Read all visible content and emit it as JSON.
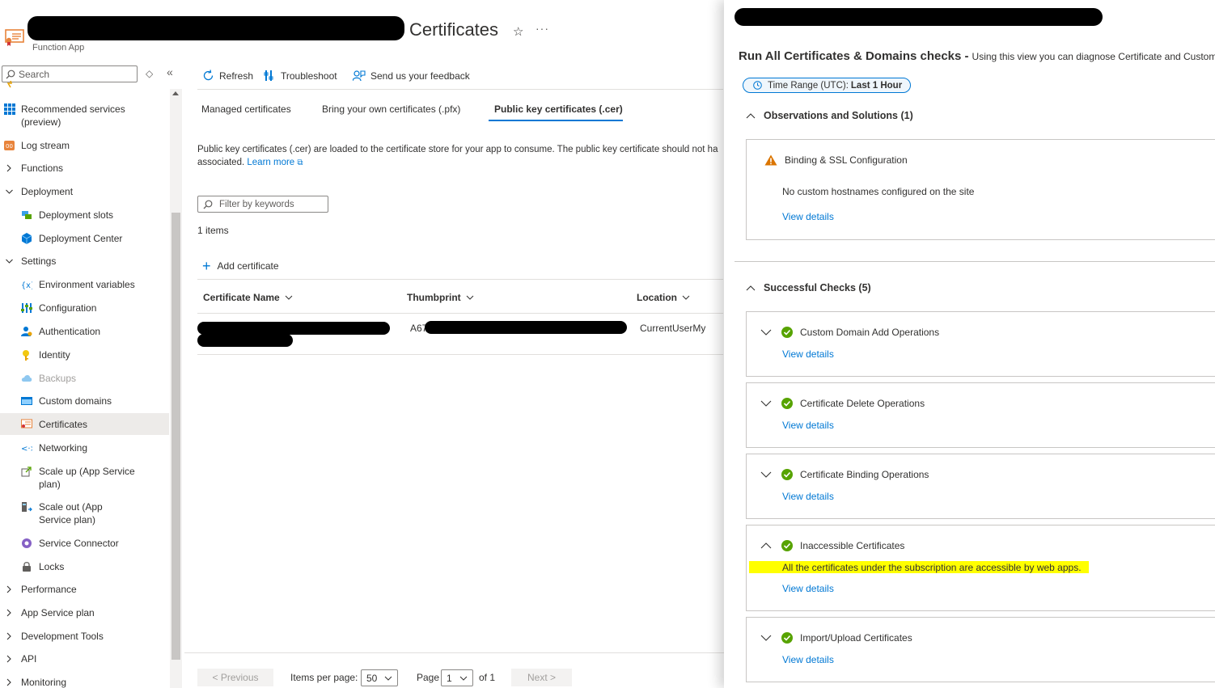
{
  "header": {
    "title": "Certificates",
    "subtitle": "Function App",
    "favorite_icon": "star-icon",
    "more_icon": "more-icon",
    "more_label": "···"
  },
  "sidebar": {
    "search_placeholder": "Search",
    "nav_items": [
      {
        "label": "Recommended services (preview)",
        "icon": "recommended-services-icon",
        "type": "top"
      },
      {
        "label": "Log stream",
        "icon": "log-stream-icon",
        "type": "top"
      },
      {
        "label": "Functions",
        "type": "group"
      },
      {
        "label": "Deployment",
        "type": "group-open"
      },
      {
        "label": "Deployment slots",
        "icon": "deployment-slots-icon",
        "type": "sub"
      },
      {
        "label": "Deployment Center",
        "icon": "deployment-center-icon",
        "type": "sub"
      },
      {
        "label": "Settings",
        "type": "group-open"
      },
      {
        "label": "Environment variables",
        "icon": "environment-variables-icon",
        "type": "sub"
      },
      {
        "label": "Configuration",
        "icon": "configuration-icon",
        "type": "sub"
      },
      {
        "label": "Authentication",
        "icon": "authentication-icon",
        "type": "sub"
      },
      {
        "label": "Identity",
        "icon": "identity-icon",
        "type": "sub"
      },
      {
        "label": "Backups",
        "icon": "backups-icon",
        "type": "sub",
        "disabled": true
      },
      {
        "label": "Custom domains",
        "icon": "custom-domains-icon",
        "type": "sub"
      },
      {
        "label": "Certificates",
        "icon": "certificates-icon",
        "type": "sub",
        "active": true
      },
      {
        "label": "Networking",
        "icon": "networking-icon",
        "type": "sub"
      },
      {
        "label": "Scale up (App Service plan)",
        "icon": "scale-up-icon",
        "type": "sub"
      },
      {
        "label": "Scale out (App Service plan)",
        "icon": "scale-out-icon",
        "type": "sub"
      },
      {
        "label": "Service Connector",
        "icon": "service-connector-icon",
        "type": "sub"
      },
      {
        "label": "Locks",
        "icon": "locks-icon",
        "type": "sub"
      },
      {
        "label": "Performance",
        "type": "group"
      },
      {
        "label": "App Service plan",
        "type": "group"
      },
      {
        "label": "Development Tools",
        "type": "group"
      },
      {
        "label": "API",
        "type": "group"
      },
      {
        "label": "Monitoring",
        "type": "group"
      }
    ]
  },
  "toolbar": {
    "refresh": "Refresh",
    "troubleshoot": "Troubleshoot",
    "feedback": "Send us your feedback"
  },
  "tabs": {
    "managed": "Managed certificates",
    "byo": "Bring your own certificates (.pfx)",
    "public": "Public key certificates (.cer)"
  },
  "main": {
    "description_line1": "Public key certificates (.cer) are loaded to the certificate store for your app to consume. The public key certificate should not ha",
    "description_line2": "associated.",
    "learn_more": "Learn more",
    "filter_placeholder": "Filter by keywords",
    "items_count": "1 items",
    "add_certificate": "Add certificate",
    "columns": {
      "name": "Certificate Name",
      "thumbprint": "Thumbprint",
      "location": "Location"
    },
    "row": {
      "thumbprint_prefix": "A67",
      "location": "CurrentUserMy"
    }
  },
  "pager": {
    "previous": "< Previous",
    "items_per_page_label": "Items per page:",
    "items_per_page": "50",
    "page_label": "Page",
    "page": "1",
    "of": "of 1",
    "next": "Next >"
  },
  "blade": {
    "title": "Run All Certificates & Domains checks -",
    "title_sub": "Using this view you can diagnose Certificate and Custom D",
    "time_range_label": "Time Range (UTC):",
    "time_range_value": "Last 1 Hour",
    "observations_heading": "Observations and Solutions (1)",
    "observation": {
      "title": "Binding & SSL Configuration",
      "text": "No custom hostnames configured on the site",
      "link": "View details"
    },
    "successful_heading": "Successful Checks (5)",
    "checks": [
      {
        "title": "Custom Domain Add Operations",
        "link": "View details"
      },
      {
        "title": "Certificate Delete Operations",
        "link": "View details"
      },
      {
        "title": "Certificate Binding Operations",
        "link": "View details"
      },
      {
        "title": "Inaccessible Certificates",
        "text": "All the certificates under the subscription are accessible by web apps.",
        "link": "View details",
        "expanded": true
      },
      {
        "title": "Import/Upload Certificates",
        "link": "View details"
      }
    ]
  },
  "colors": {
    "accent": "#0078d4",
    "success": "#57a300",
    "warning": "#db7500",
    "highlight": "#ffff00"
  }
}
